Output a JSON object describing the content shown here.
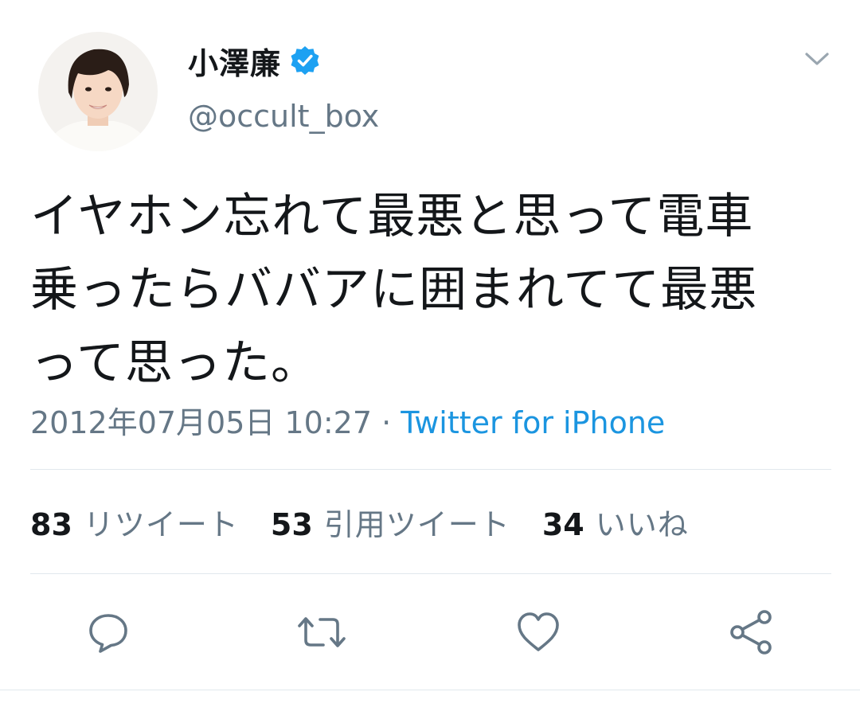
{
  "user": {
    "display_name": "小澤廉",
    "handle": "@occult_box",
    "verified": true,
    "avatar": "profile-photo"
  },
  "tweet": {
    "text": "イヤホン忘れて最悪と思って電車\n乗ったらババアに囲まれてて最悪\nって思った。",
    "timestamp": "2012年07月05日 10:27",
    "separator": " · ",
    "source": "Twitter for iPhone"
  },
  "stats": [
    {
      "count": "83",
      "label": "リツイート"
    },
    {
      "count": "53",
      "label": "引用ツイート"
    },
    {
      "count": "34",
      "label": "いいね"
    }
  ],
  "actions": [
    {
      "name": "reply",
      "icon": "reply-icon"
    },
    {
      "name": "retweet",
      "icon": "retweet-icon"
    },
    {
      "name": "like",
      "icon": "heart-icon"
    },
    {
      "name": "share",
      "icon": "share-icon"
    }
  ],
  "colors": {
    "text": "#14171a",
    "secondary": "#657786",
    "link": "#1b95e0",
    "verified": "#1da1f2",
    "divider": "#e1e8ed"
  }
}
